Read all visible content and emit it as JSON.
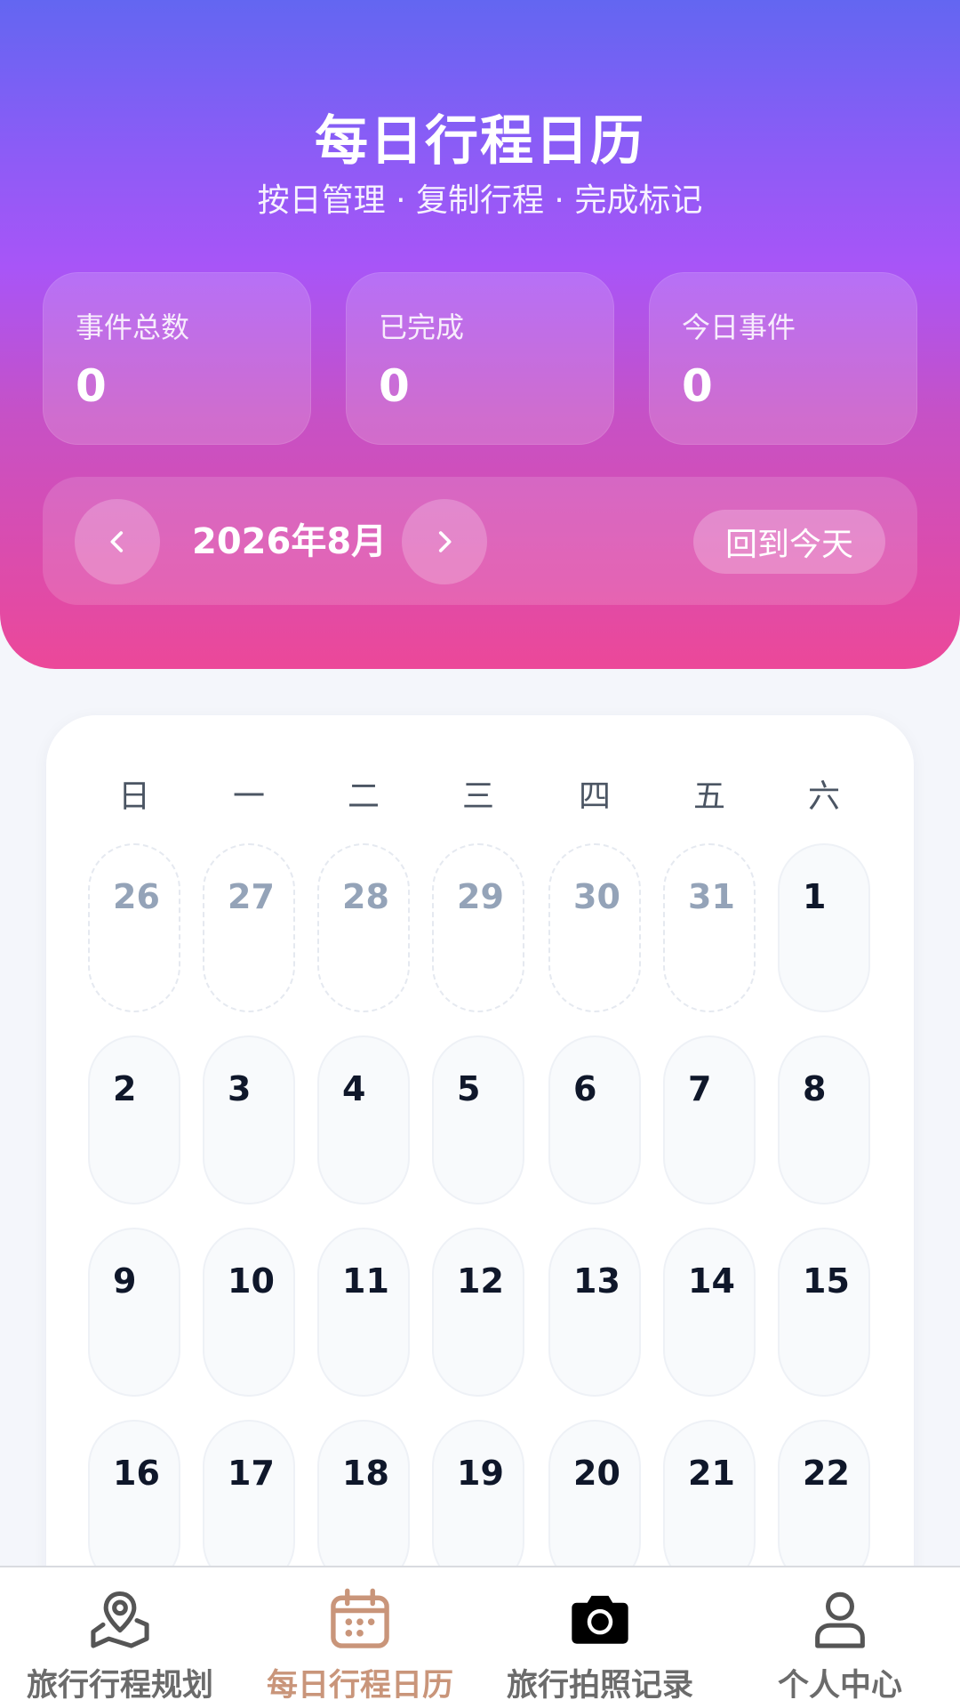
{
  "header": {
    "title": "每日行程日历",
    "subtitle": "按日管理 · 复制行程 · 完成标记"
  },
  "stats": [
    {
      "label": "事件总数",
      "value": "0"
    },
    {
      "label": "已完成",
      "value": "0"
    },
    {
      "label": "今日事件",
      "value": "0"
    }
  ],
  "month_bar": {
    "label": "2026年8月",
    "today_label": "回到今天",
    "prev_icon": "chevron-left-icon",
    "next_icon": "chevron-right-icon"
  },
  "calendar": {
    "weekdays": [
      "日",
      "一",
      "二",
      "三",
      "四",
      "五",
      "六"
    ],
    "rows": [
      [
        "26",
        "27",
        "28",
        "29",
        "30",
        "31",
        "1"
      ],
      [
        "2",
        "3",
        "4",
        "5",
        "6",
        "7",
        "8"
      ],
      [
        "9",
        "10",
        "11",
        "12",
        "13",
        "14",
        "15"
      ],
      [
        "16",
        "17",
        "18",
        "19",
        "20",
        "21",
        "22"
      ]
    ],
    "outside_month": [
      [
        0,
        0
      ],
      [
        0,
        1
      ],
      [
        0,
        2
      ],
      [
        0,
        3
      ],
      [
        0,
        4
      ],
      [
        0,
        5
      ]
    ]
  },
  "bottom_nav": {
    "active_index": 1,
    "items": [
      {
        "label": "旅行行程规划",
        "icon": "map-pin-icon"
      },
      {
        "label": "每日行程日历",
        "icon": "calendar-icon"
      },
      {
        "label": "旅行拍照记录",
        "icon": "camera-icon"
      },
      {
        "label": "个人中心",
        "icon": "user-icon"
      }
    ]
  },
  "colors": {
    "gradient_top": "#6366f1",
    "gradient_mid": "#a855f7",
    "gradient_bottom": "#ec4899",
    "nav_active": "#c9957a",
    "nav_inactive": "#6b6b6b"
  }
}
